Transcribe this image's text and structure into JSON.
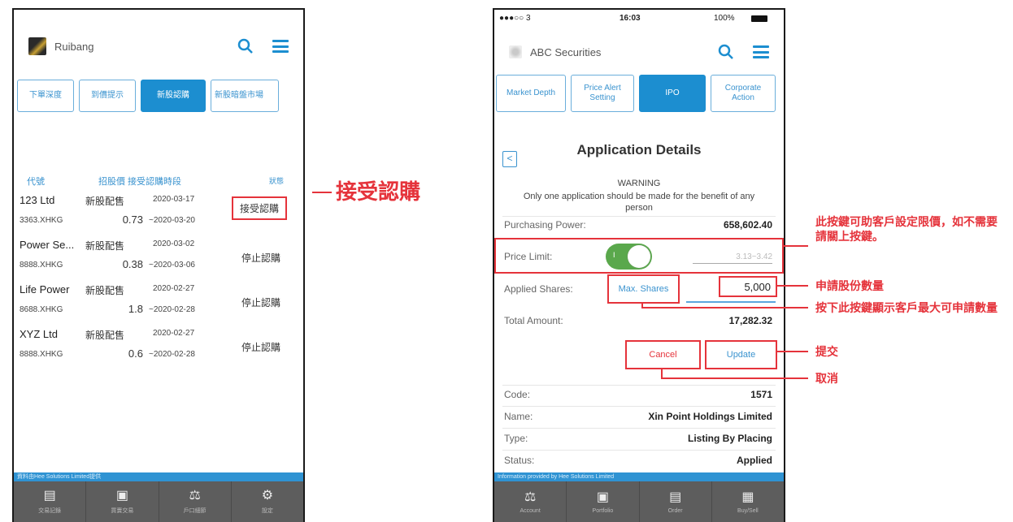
{
  "left_phone": {
    "app_name": "Ruibang",
    "tabs": [
      {
        "label": "下單深度",
        "active": false
      },
      {
        "label": "到價提示",
        "active": false
      },
      {
        "label": "新股認購",
        "active": true
      },
      {
        "label": "新股暗盤市場",
        "active": false
      }
    ],
    "table_header": {
      "code": "代號",
      "price": "招股價",
      "period": "接受認購時段",
      "status": "狀態"
    },
    "rows": [
      {
        "name": "123 Ltd",
        "code": "3363.XHKG",
        "type": "新股配售",
        "price": "0.73",
        "date_from": "2020-03-17",
        "date_to": "~2020-03-20",
        "status": "接受認購"
      },
      {
        "name": "Power Se...",
        "code": "8888.XHKG",
        "type": "新股配售",
        "price": "0.38",
        "date_from": "2020-03-02",
        "date_to": "~2020-03-06",
        "status": "停止認購"
      },
      {
        "name": "Life Power",
        "code": "8688.XHKG",
        "type": "新股配售",
        "price": "1.8",
        "date_from": "2020-02-27",
        "date_to": "~2020-02-28",
        "status": "停止認購"
      },
      {
        "name": "XYZ Ltd",
        "code": "8888.XHKG",
        "type": "新股配售",
        "price": "0.6",
        "date_from": "2020-02-27",
        "date_to": "~2020-02-28",
        "status": "停止認購"
      }
    ],
    "bottom_strip": "資料由Hee Solutions Limited提供",
    "nav": [
      {
        "label": "交易記錄",
        "icon": "clipboard-icon"
      },
      {
        "label": "買賣交易",
        "icon": "wallet-icon"
      },
      {
        "label": "戶口細節",
        "icon": "scale-icon"
      },
      {
        "label": "設定",
        "icon": "gear-icon"
      }
    ]
  },
  "right_phone": {
    "status_bar": {
      "signal": "●●●○○ 3",
      "time": "16:03",
      "battery": "100%"
    },
    "app_name": "ABC Securities",
    "tabs": [
      {
        "label": "Market Depth",
        "active": false
      },
      {
        "label": "Price Alert Setting",
        "active": false
      },
      {
        "label": "IPO",
        "active": true
      },
      {
        "label": "Corporate Action",
        "active": false
      }
    ],
    "back_label": "<",
    "title": "Application Details",
    "warning_title": "WARNING",
    "warning_text": "Only one application should be made for the benefit of any person",
    "purchasing_power_label": "Purchasing Power:",
    "purchasing_power": "658,602.40",
    "price_limit_label": "Price Limit:",
    "price_limit_toggle": "I",
    "price_limit_range": "3.13~3.42",
    "applied_shares_label": "Applied Shares:",
    "max_shares_label": "Max. Shares",
    "applied_shares": "5,000",
    "total_amount_label": "Total Amount:",
    "total_amount": "17,282.32",
    "cancel_label": "Cancel",
    "update_label": "Update",
    "code_label": "Code:",
    "code": "1571",
    "name_label": "Name:",
    "name": "Xin Point Holdings Limited",
    "type_label": "Type:",
    "type": "Listing By Placing",
    "status_label": "Status:",
    "status": "Applied",
    "bottom_strip": "Information provided by Hee Solutions Limited",
    "nav": [
      {
        "label": "Account",
        "icon": "scale-icon"
      },
      {
        "label": "Portfolio",
        "icon": "wallet-icon"
      },
      {
        "label": "Order",
        "icon": "clipboard-icon"
      },
      {
        "label": "Buy/Sell",
        "icon": "cash-icon"
      }
    ]
  },
  "annotations": {
    "accept": "接受認購",
    "price_limit": "此按鍵可助客戶設定限價，如不需要請關上按鍵。",
    "applied_shares": "申請股份數量",
    "max_shares": "按下此按鍵顯示客戶最大可申請數量",
    "submit": "提交",
    "cancel": "取消"
  },
  "colors": {
    "accent": "#1c8ed0",
    "annotation_red": "#e5333b",
    "toggle_green": "#5aa84c",
    "nav_bg": "#5d5d5d"
  }
}
